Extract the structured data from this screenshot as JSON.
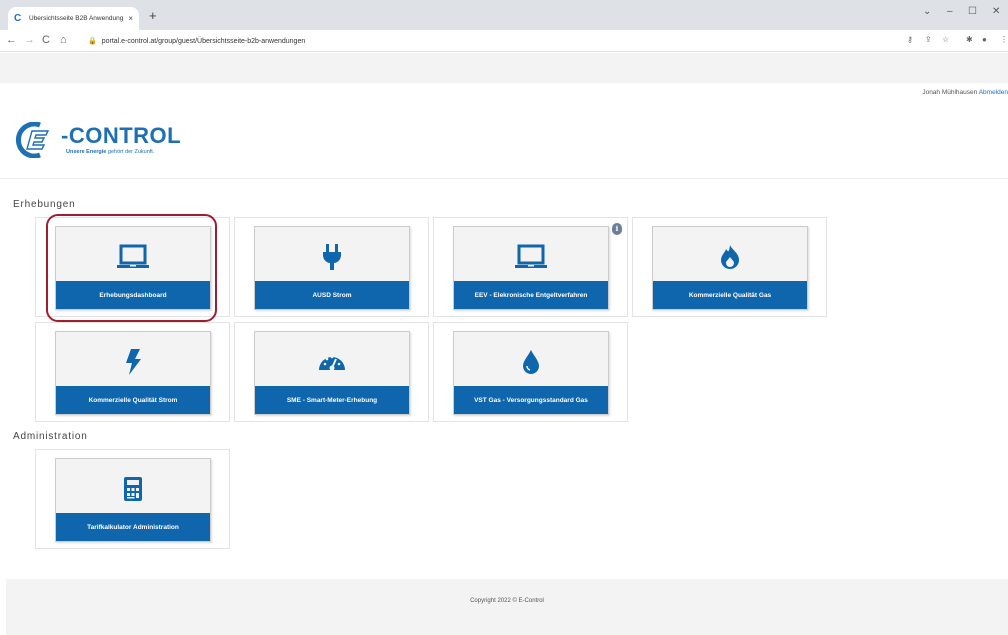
{
  "browser": {
    "tab_title": "Übersichtsseite B2B Anwendung",
    "tab_close": "×",
    "new_tab": "+",
    "url": "portal.e-control.at/group/guest/Übersichtsseite-b2b-anwendungen"
  },
  "header": {
    "user_name": "Jonah Mühlhausen",
    "logout_label": "Abmelden"
  },
  "logo": {
    "word": "-CONTROL",
    "claim_bold": "Unsere Energie",
    "claim_rest": " gehört der Zukunft."
  },
  "sections": {
    "erhebungen_title": "Erhebungen",
    "administration_title": "Administration"
  },
  "cards": {
    "erhebungsdashboard": {
      "label": "Erhebungsdashboard",
      "icon": "laptop-icon"
    },
    "ausd_strom": {
      "label": "AUSD Strom",
      "icon": "plug-icon"
    },
    "eev": {
      "label": "EEV - Elekronische Entgeltverfahren",
      "icon": "laptop-icon"
    },
    "kq_gas": {
      "label": "Kommerzielle Qualität Gas",
      "icon": "flame-icon"
    },
    "kq_strom": {
      "label": "Kommerzielle Qualität Strom",
      "icon": "bolt-icon"
    },
    "sme": {
      "label": "SME - Smart-Meter-Erhebung",
      "icon": "gauge-icon"
    },
    "vst_gas": {
      "label": "VST Gas - Versorgungsstandard Gas",
      "icon": "drop-icon"
    },
    "tarifkalkulator": {
      "label": "Tarifkalkulator Administration",
      "icon": "calculator-icon"
    }
  },
  "info_badge": "i",
  "footer": {
    "copyright": "Copyright 2022 © E-Control"
  },
  "colors": {
    "brand_blue": "#0f66ad",
    "highlight": "#a01c30"
  }
}
